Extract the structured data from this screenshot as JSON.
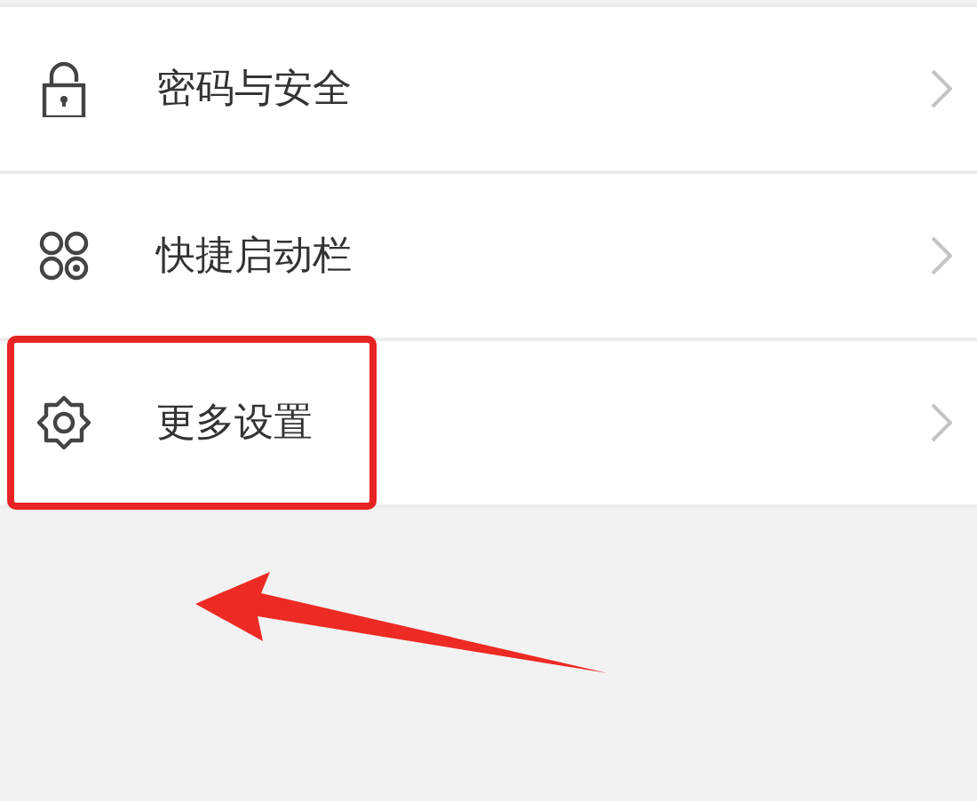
{
  "settings_list": [
    {
      "label": "密码与安全",
      "highlighted": false
    },
    {
      "label": "快捷启动栏",
      "highlighted": false
    },
    {
      "label": "更多设置",
      "highlighted": true
    }
  ]
}
